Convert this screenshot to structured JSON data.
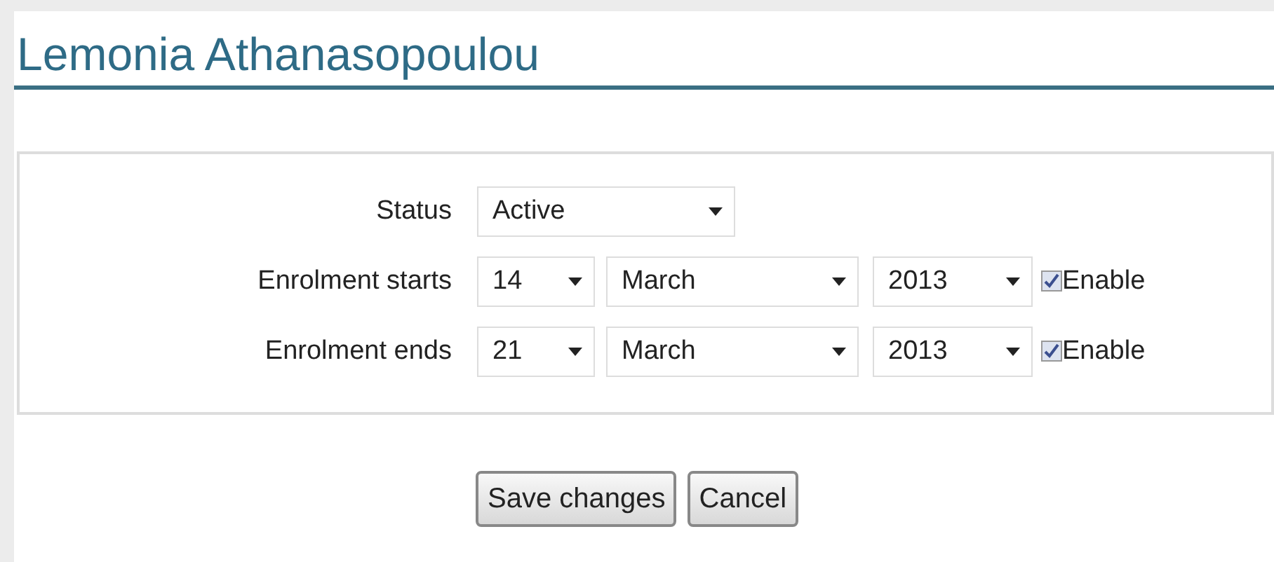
{
  "title": "Lemonia Athanasopoulou",
  "rows": [
    {
      "label": "Status",
      "kind": "select",
      "value": "Active"
    },
    {
      "label": "Enrolment starts",
      "kind": "date",
      "day": "14",
      "month": "March",
      "year": "2013",
      "enable": {
        "label": "Enable",
        "checked": true
      }
    },
    {
      "label": "Enrolment ends",
      "kind": "date",
      "day": "21",
      "month": "March",
      "year": "2013",
      "enable": {
        "label": "Enable",
        "checked": true
      }
    }
  ],
  "buttons": [
    "Save changes",
    "Cancel"
  ]
}
